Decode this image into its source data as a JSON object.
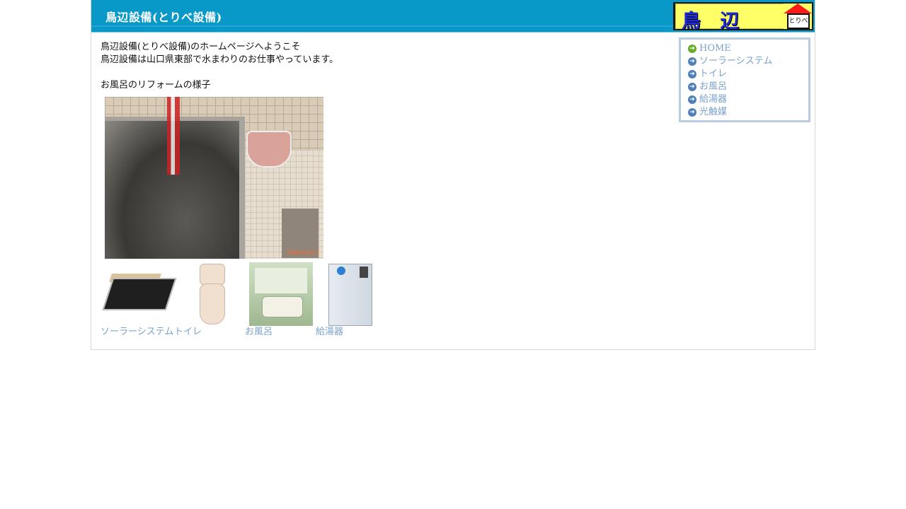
{
  "header": {
    "title": "鳥辺設備(とりべ設備)",
    "logo_text": "鳥 辺 設 備",
    "logo_house_text": "とりべ",
    "colors": {
      "header_bg": "#0999c9",
      "logo_bg": "#ffff66",
      "logo_text": "#1e2bd6"
    }
  },
  "intro": {
    "line1": "鳥辺設備(とりべ設備)のホームページへようこそ",
    "line2": "鳥辺設備は山口県東部で水まわりのお仕事やっています。",
    "section_title": "お風呂のリフォームの様子"
  },
  "photo": {
    "icon": "bath-reform-photo",
    "datestamp": "2006/10/17"
  },
  "nav": {
    "items": [
      {
        "label": "HOME",
        "icon": "arrow-right-icon",
        "active": true
      },
      {
        "label": "ソーラーシステム",
        "icon": "arrow-right-icon"
      },
      {
        "label": "トイレ",
        "icon": "arrow-right-icon"
      },
      {
        "label": "お風呂",
        "icon": "arrow-right-icon"
      },
      {
        "label": "給湯器",
        "icon": "arrow-right-icon"
      },
      {
        "label": "光触媒",
        "icon": "arrow-right-icon"
      }
    ],
    "link_color": "#7aa1cc"
  },
  "thumbs": {
    "items": [
      {
        "label": "ソーラーシステム",
        "icon": "solar-panel-image"
      },
      {
        "label": "トイレ",
        "icon": "toilet-image"
      },
      {
        "label": "お風呂",
        "icon": "bathroom-image"
      },
      {
        "label": "給湯器",
        "icon": "water-heater-image"
      }
    ]
  }
}
